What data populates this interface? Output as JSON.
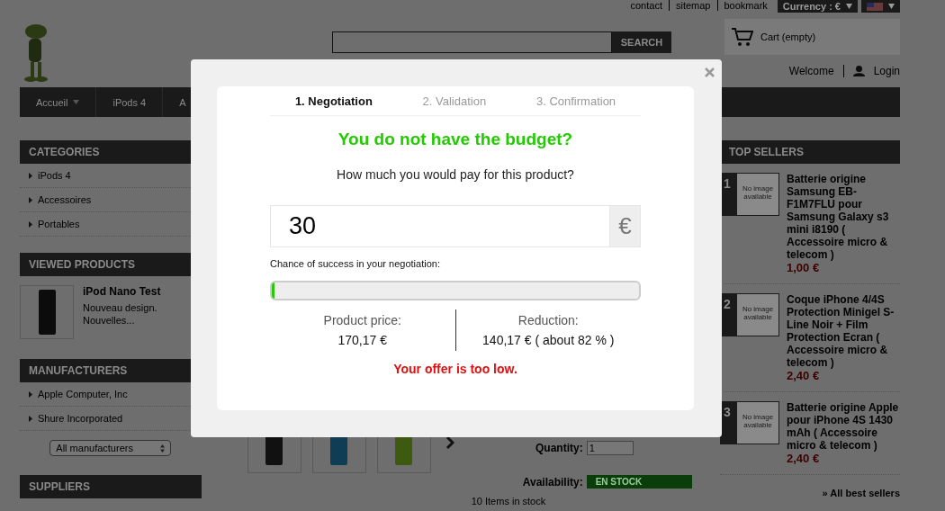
{
  "top_links": [
    "contact",
    "sitemap",
    "bookmark"
  ],
  "currency": {
    "label": "Currency : €"
  },
  "search": {
    "button": "SEARCH"
  },
  "cart": {
    "label": "Cart (empty)"
  },
  "account": {
    "welcome": "Welcome",
    "login": "Login"
  },
  "nav": [
    {
      "label": "Accueil",
      "dropdown": true
    },
    {
      "label": "iPods 4",
      "dropdown": false
    },
    {
      "label": "A",
      "dropdown": false
    }
  ],
  "categories": {
    "title": "CATEGORIES",
    "items": [
      "iPods 4",
      "Accessoires",
      "Portables"
    ]
  },
  "viewed_products": {
    "title": "VIEWED PRODUCTS",
    "items": [
      {
        "name": "iPod Nano Test",
        "description": "Nouveau design. Nouvelles..."
      }
    ]
  },
  "manufacturers": {
    "title": "MANUFACTURERS",
    "items": [
      "Apple Computer, Inc",
      "Shure Incorporated"
    ],
    "select": "All manufacturers"
  },
  "suppliers": {
    "title": "SUPPLIERS"
  },
  "product": {
    "thumbnails": [
      {
        "color": "#111111"
      },
      {
        "color": "#0e3d55"
      },
      {
        "color": "#3d5a10"
      }
    ],
    "quantity_label": "Quantity:",
    "quantity": "1",
    "availability_label": "Availability:",
    "availability": "EN STOCK",
    "stock": "10 Items in stock"
  },
  "top_sellers": {
    "title": "TOP SELLERS",
    "items": [
      {
        "rank": "1",
        "image": "No image available",
        "name": "Batterie origine Samsung EB-F1M7FLU pour Samsung Galaxy s3 mini i8190 ( Accessoire micro & telecom )",
        "price": "1,00 €"
      },
      {
        "rank": "2",
        "image": "No image available",
        "name": "Coque iPhone 4/4S Protection Minigel S-Line Noir + Film Protection Ecran ( Accessoire micro & telecom )",
        "price": "2,40 €"
      },
      {
        "rank": "3",
        "image": "No image available",
        "name": "Batterie origine Apple pour iPhone 4S 1430 mAh ( Accessoire micro & telecom )",
        "price": "2,40 €"
      }
    ],
    "link": "» All best sellers"
  },
  "modal": {
    "steps": [
      {
        "label": "1. Negotiation",
        "selected": true
      },
      {
        "label": "2. Validation",
        "selected": false
      },
      {
        "label": "3. Confirmation",
        "selected": false
      }
    ],
    "heading": "You do not have the budget?",
    "question": "How much you would pay for this product?",
    "offer": "30",
    "currency": "€",
    "chance_label": "Chance of success in your negotiation:",
    "chance": {
      "level": 0
    },
    "price_label": "Product price:",
    "price": "170,17 €",
    "reduction_label": "Reduction:",
    "reduction": "140,17 € ( about 82 % )",
    "message": "Your offer is too low."
  }
}
